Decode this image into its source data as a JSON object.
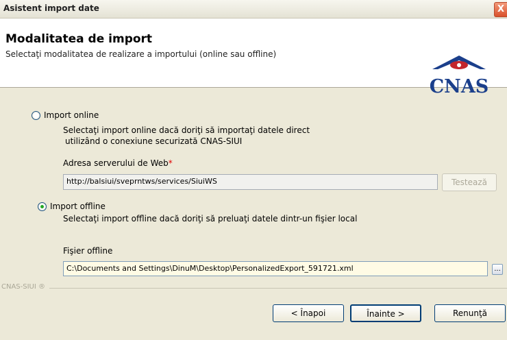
{
  "window": {
    "title": "Asistent import date",
    "close_glyph": "X"
  },
  "header": {
    "title": "Modalitatea de import",
    "subtitle": "Selectaţi modalitatea de realizare a importului (online sau offline)",
    "logo_text": "CNAS"
  },
  "online": {
    "label": "Import online",
    "checked": false,
    "desc_line1": "Selectaţi import online dacă doriţi să importaţi datele direct",
    "desc_line2": "utilizând o conexiune securizată CNAS-SIUI",
    "server_label": "Adresa serverului de Web",
    "required_mark": "*",
    "server_value": "http://balsiui/sveprntws/services/SiuiWS",
    "test_button": "Testează"
  },
  "offline": {
    "label": "Import offline",
    "checked": true,
    "desc": "Selectaţi import offline dacă doriţi să preluaţi datele dintr-un fişier local",
    "file_label": "Fişier offline",
    "file_value": "C:\\Documents and Settings\\DinuM\\Desktop\\PersonalizedExport_591721.xml",
    "browse_glyph": "..."
  },
  "footer": {
    "brand": "CNAS-SIUI ®",
    "back_button": "< Înapoi",
    "next_button": "Înainte >",
    "cancel_button": "Renunţă"
  },
  "colors": {
    "logo_red": "#c3262c",
    "logo_blue": "#1b3f8b",
    "radio_dot": "#24a824"
  }
}
